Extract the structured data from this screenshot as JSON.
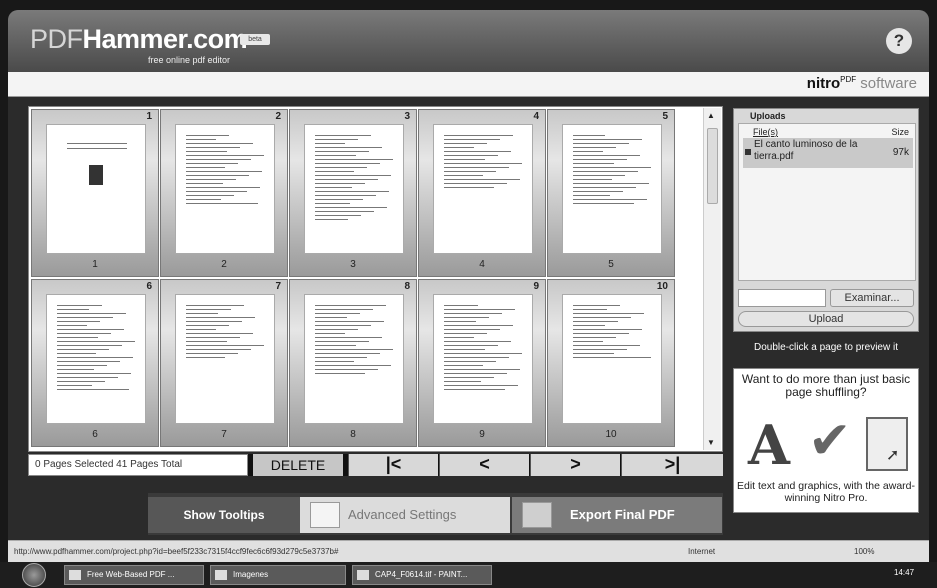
{
  "header": {
    "logo_pdf": "PDF",
    "logo_main": "Hammer.com",
    "beta_badge": "beta",
    "tagline": "free online pdf editor",
    "help_label": "?"
  },
  "brand": {
    "nitro": "nitro",
    "sup": "PDF",
    "software": "software"
  },
  "pages": [
    {
      "num": "1",
      "label": "1"
    },
    {
      "num": "2",
      "label": "2"
    },
    {
      "num": "3",
      "label": "3"
    },
    {
      "num": "4",
      "label": "4"
    },
    {
      "num": "5",
      "label": "5"
    },
    {
      "num": "6",
      "label": "6"
    },
    {
      "num": "7",
      "label": "7"
    },
    {
      "num": "8",
      "label": "8"
    },
    {
      "num": "9",
      "label": "9"
    },
    {
      "num": "10",
      "label": "10"
    }
  ],
  "pager": {
    "status": "0 Pages Selected  41 Pages Total",
    "delete_label": "DELETE",
    "first_label": "|<",
    "prev_label": "<",
    "next_label": ">",
    "last_label": ">|"
  },
  "uploads": {
    "title": "Uploads",
    "col_file": "File(s)",
    "col_size": "Size",
    "file_name": "El canto luminoso de la tierra.pdf",
    "file_size": "97k",
    "browse_label": "Examinar...",
    "upload_label": "Upload"
  },
  "hint": "Double-click a page to preview it",
  "promo": {
    "headline": "Want to do more than just basic page shuffling?",
    "body": "Edit text and graphics, with the award-winning Nitro Pro."
  },
  "actions": {
    "tooltips_label": "Show Tooltips",
    "advanced_label": "Advanced Settings",
    "export_label": "Export Final PDF"
  },
  "browser": {
    "url": "http://www.pdfhammer.com/project.php?id=beef5f233c7315f4ccf9fec6c6f93d279c5e3737b#",
    "zone": "Internet",
    "zoom": "100%"
  },
  "taskbar": {
    "tasks": [
      "Free Web-Based PDF ...",
      "Imagenes",
      "CAP4_F0614.tif - PAINT..."
    ],
    "clock": "14:47"
  }
}
